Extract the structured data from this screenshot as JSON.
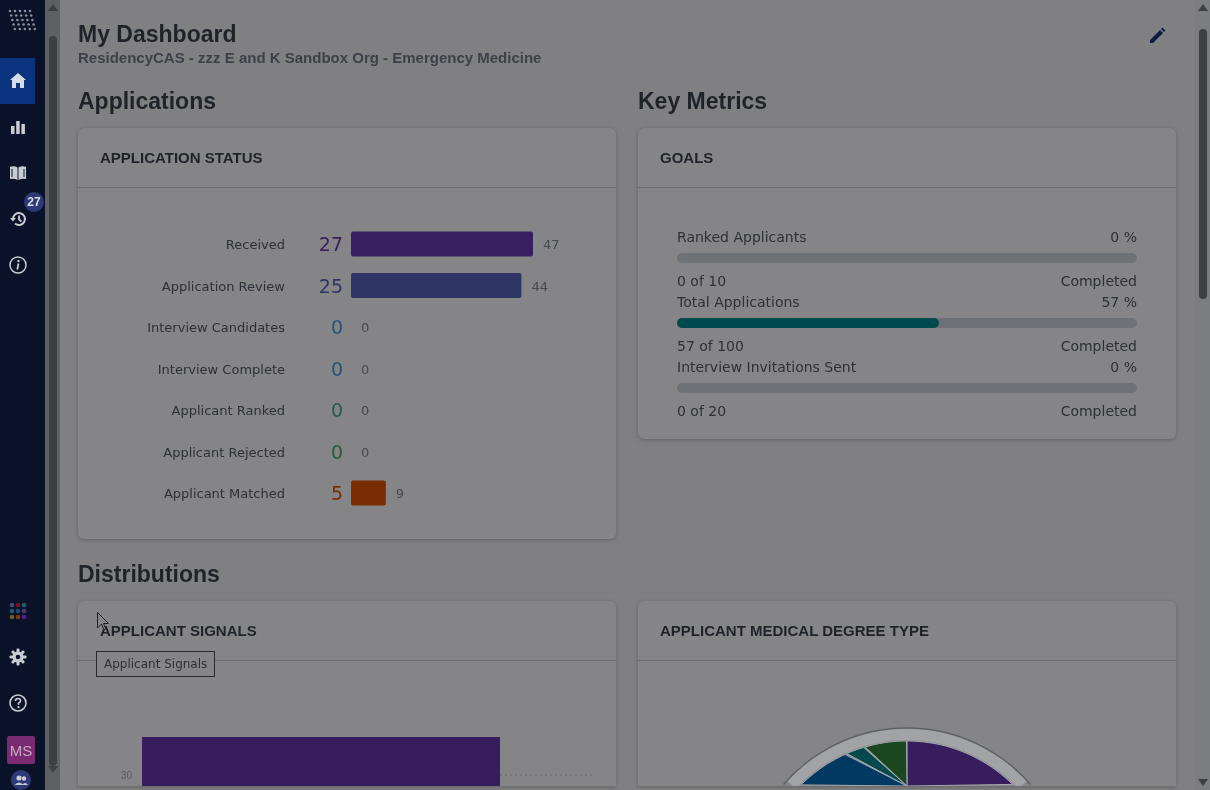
{
  "sidebar": {
    "items": [
      {
        "kind": "home",
        "selected": true
      },
      {
        "kind": "reports",
        "selected": false
      },
      {
        "kind": "guide",
        "selected": false
      },
      {
        "kind": "history",
        "selected": false,
        "badge": "27"
      },
      {
        "kind": "info",
        "selected": false
      }
    ],
    "bottom_items": [
      {
        "kind": "apps"
      },
      {
        "kind": "settings"
      },
      {
        "kind": "help"
      }
    ],
    "avatar": "MS"
  },
  "header": {
    "title": "My Dashboard",
    "subtitle": "ResidencyCAS - zzz E and K Sandbox Org - Emergency Medicine"
  },
  "applications": {
    "heading": "Applications",
    "card_title": "APPLICATION STATUS",
    "chart_data": {
      "type": "bar",
      "orientation": "horizontal",
      "categories": [
        "Received",
        "Application Review",
        "Interview Candidates",
        "Interview Complete",
        "Applicant Ranked",
        "Applicant Rejected",
        "Applicant Matched"
      ],
      "values": [
        47,
        44,
        0,
        0,
        0,
        0,
        9
      ],
      "value_labels": [
        "47",
        "44",
        "0",
        "0",
        "0",
        "0",
        "9"
      ]
    },
    "rows": [
      {
        "count": "27",
        "color": "#382060"
      },
      {
        "count": "25",
        "color": "#2e3464"
      },
      {
        "count": "0",
        "color": "#1d5876"
      },
      {
        "count": "0",
        "color": "#1d5876"
      },
      {
        "count": "0",
        "color": "#2a5a48"
      },
      {
        "count": "0",
        "color": "#2a5a3c"
      },
      {
        "count": "5",
        "color": "#7a2c02"
      }
    ]
  },
  "key_metrics": {
    "heading": "Key Metrics",
    "card_title": "GOALS",
    "goals": [
      {
        "label": "Ranked Applicants",
        "percent": "0 %",
        "level": 0,
        "progress": "0 of 10",
        "status": "Completed"
      },
      {
        "label": "Total Applications",
        "percent": "57 %",
        "level": 0.57,
        "progress": "57 of 100",
        "status": "Completed"
      },
      {
        "label": "Interview Invitations Sent",
        "percent": "0 %",
        "level": 0,
        "progress": "0 of 20",
        "status": "Completed"
      }
    ]
  },
  "distributions": {
    "heading": "Distributions",
    "cards": [
      {
        "title": "APPLICANT SIGNALS",
        "kind": "bar",
        "y_tick": "30"
      },
      {
        "title": "APPLICANT MEDICAL DEGREE TYPE",
        "kind": "pie"
      }
    ]
  },
  "tooltip": {
    "text": "Applicant Signals"
  }
}
